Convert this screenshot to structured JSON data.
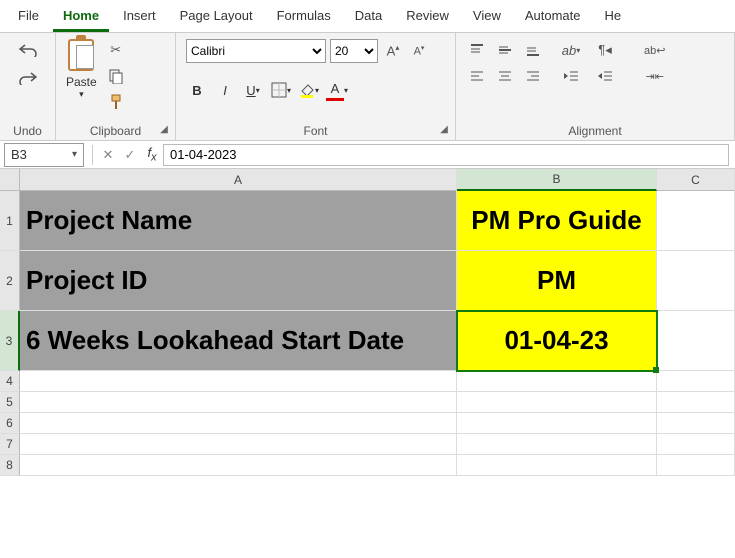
{
  "menu": {
    "tabs": [
      "File",
      "Home",
      "Insert",
      "Page Layout",
      "Formulas",
      "Data",
      "Review",
      "View",
      "Automate",
      "He"
    ],
    "active": "Home"
  },
  "ribbon": {
    "undo": {
      "label": "Undo"
    },
    "clipboard": {
      "paste": "Paste",
      "label": "Clipboard"
    },
    "font": {
      "name": "Calibri",
      "size": "20",
      "label": "Font"
    },
    "alignment": {
      "label": "Alignment"
    }
  },
  "name_box": "B3",
  "formula_value": "01-04-2023",
  "columns": [
    "A",
    "B",
    "C"
  ],
  "rows": {
    "r1": {
      "A": "Project Name",
      "B": "PM Pro Guide"
    },
    "r2": {
      "A": "Project ID",
      "B": "PM"
    },
    "r3": {
      "A": "6 Weeks Lookahead Start Date",
      "B": "01-04-23"
    }
  }
}
